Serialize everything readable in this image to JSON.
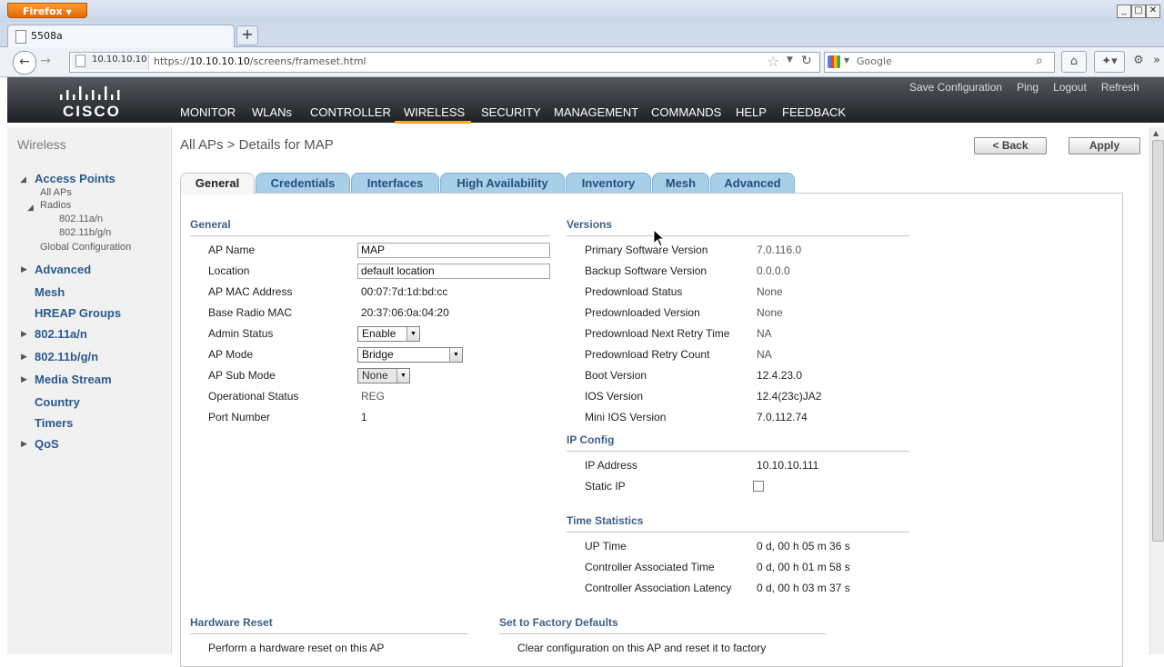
{
  "browser": {
    "menu_button": "Firefox",
    "tab_title": "5508a",
    "url_host": "10.10.10.10",
    "url_scheme": "https://",
    "url_domain": "10.10.10.10",
    "url_path": "/screens/frameset.html",
    "search_placeholder": "Google"
  },
  "brand": {
    "logo": "CISCO"
  },
  "top_links": [
    "Save Configuration",
    "Ping",
    "Logout",
    "Refresh"
  ],
  "main_menu": [
    "MONITOR",
    "WLANs",
    "CONTROLLER",
    "WIRELESS",
    "SECURITY",
    "MANAGEMENT",
    "COMMANDS",
    "HELP",
    "FEEDBACK"
  ],
  "main_menu_active": "WIRELESS",
  "sidebar": {
    "title": "Wireless",
    "access_points": "Access Points",
    "all_aps": "All APs",
    "radios": "Radios",
    "radio_a": "802.11a/n",
    "radio_bg": "802.11b/g/n",
    "global_config": "Global Configuration",
    "advanced": "Advanced",
    "mesh": "Mesh",
    "hreap": "HREAP Groups",
    "dot11a": "802.11a/n",
    "dot11bg": "802.11b/g/n",
    "media_stream": "Media Stream",
    "country": "Country",
    "timers": "Timers",
    "qos": "QoS"
  },
  "page": {
    "title": "All APs > Details for MAP",
    "back_label": "< Back",
    "apply_label": "Apply"
  },
  "tabs": [
    "General",
    "Credentials",
    "Interfaces",
    "High Availability",
    "Inventory",
    "Mesh",
    "Advanced"
  ],
  "general": {
    "heading": "General",
    "ap_name_label": "AP Name",
    "ap_name": "MAP",
    "location_label": "Location",
    "location": "default location",
    "mac_label": "AP MAC Address",
    "mac": "00:07:7d:1d:bd:cc",
    "base_mac_label": "Base Radio MAC",
    "base_mac": "20:37:06:0a:04:20",
    "admin_label": "Admin Status",
    "admin": "Enable",
    "mode_label": "AP Mode",
    "mode": "Bridge",
    "submode_label": "AP Sub Mode",
    "submode": "None",
    "opstatus_label": "Operational Status",
    "opstatus": "REG",
    "port_label": "Port Number",
    "port": "1"
  },
  "versions": {
    "heading": "Versions",
    "primary_label": "Primary Software Version",
    "primary": "7.0.116.0",
    "backup_label": "Backup Software Version",
    "backup": "0.0.0.0",
    "pd_status_label": "Predownload Status",
    "pd_status": "None",
    "pd_version_label": "Predownloaded Version",
    "pd_version": "None",
    "pd_retry_time_label": "Predownload Next Retry Time",
    "pd_retry_time": "NA",
    "pd_retry_count_label": "Predownload Retry Count",
    "pd_retry_count": "NA",
    "boot_label": "Boot Version",
    "boot": "12.4.23.0",
    "ios_label": "IOS Version",
    "ios": "12.4(23c)JA2",
    "mini_ios_label": "Mini IOS Version",
    "mini_ios": "7.0.112.74"
  },
  "ip_config": {
    "heading": "IP Config",
    "ip_label": "IP Address",
    "ip": "10.10.10.111",
    "static_label": "Static IP",
    "static_checked": false
  },
  "time_stats": {
    "heading": "Time Statistics",
    "uptime_label": "UP Time",
    "uptime": "0 d, 00 h 05 m 36 s",
    "assoc_time_label": "Controller Associated Time",
    "assoc_time": "0 d, 00 h 01 m 58 s",
    "assoc_latency_label": "Controller Association Latency",
    "assoc_latency": "0 d, 00 h 03 m 37 s"
  },
  "hardware_reset": {
    "heading": "Hardware Reset",
    "text": "Perform a hardware reset on this AP"
  },
  "factory_defaults": {
    "heading": "Set to Factory Defaults",
    "text": "Clear configuration on this AP and reset it to factory"
  },
  "colors": {
    "menu_active_underline": "#f6a623",
    "tab_inactive": "#a9cfe8",
    "section_heading": "#3f5f87",
    "sidebar_link": "#295a8f"
  }
}
